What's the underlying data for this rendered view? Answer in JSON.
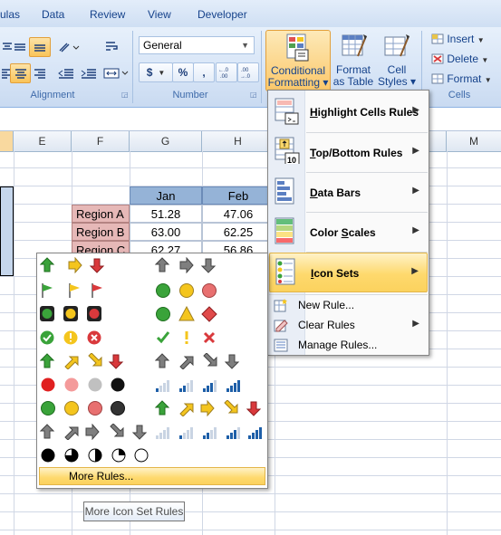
{
  "ribbon": {
    "tabs": [
      "ulas",
      "Data",
      "Review",
      "View",
      "Developer"
    ],
    "groups": {
      "alignment": "Alignment",
      "number": "Number",
      "cells": "Cells"
    },
    "number_format": "General",
    "number_buttons": [
      "$",
      "%",
      ","
    ],
    "decimal_buttons": [
      ".0→.00",
      ".00→.0"
    ],
    "styles": {
      "conditional_formatting": [
        "Conditional",
        "Formatting ▾"
      ],
      "format_as_table": [
        "Format",
        "as Table ▾"
      ],
      "cell_styles": [
        "Cell",
        "Styles ▾"
      ]
    },
    "cells": {
      "insert": "Insert",
      "delete": "Delete",
      "format": "Format"
    }
  },
  "sheet": {
    "columns": [
      "E",
      "F",
      "G",
      "H",
      "M"
    ],
    "months": [
      "Jan",
      "Feb"
    ],
    "rows": [
      {
        "region": "Region A",
        "jan": "51.28",
        "feb": "47.06"
      },
      {
        "region": "Region B",
        "jan": "63.00",
        "feb": "62.25"
      },
      {
        "region": "Region C",
        "jan": "62.27",
        "feb": "56.86"
      }
    ]
  },
  "cf_menu": {
    "items": [
      {
        "label": "Highlight Cells Rules",
        "accel": "H"
      },
      {
        "label": "Top/Bottom Rules",
        "accel": "T"
      },
      {
        "label": "Data Bars",
        "accel": "D"
      },
      {
        "label": "Color Scales",
        "accel": "S"
      },
      {
        "label": "Icon Sets",
        "accel": "I",
        "highlighted": true
      }
    ],
    "small_items": [
      "New Rule...",
      "Clear Rules",
      "Manage Rules..."
    ]
  },
  "icon_menu": {
    "more_rules": "More Rules..."
  },
  "tooltip": "More Icon Set Rules",
  "colors": {
    "ribbon_text": "#15428b",
    "month_header": "#95b3d7",
    "region_fill": "#e6b8b7",
    "highlight": "#fed96d",
    "green": "#3aa33a",
    "yellow": "#f4c51d",
    "red": "#d9393c",
    "gray": "#7f7f7f"
  }
}
